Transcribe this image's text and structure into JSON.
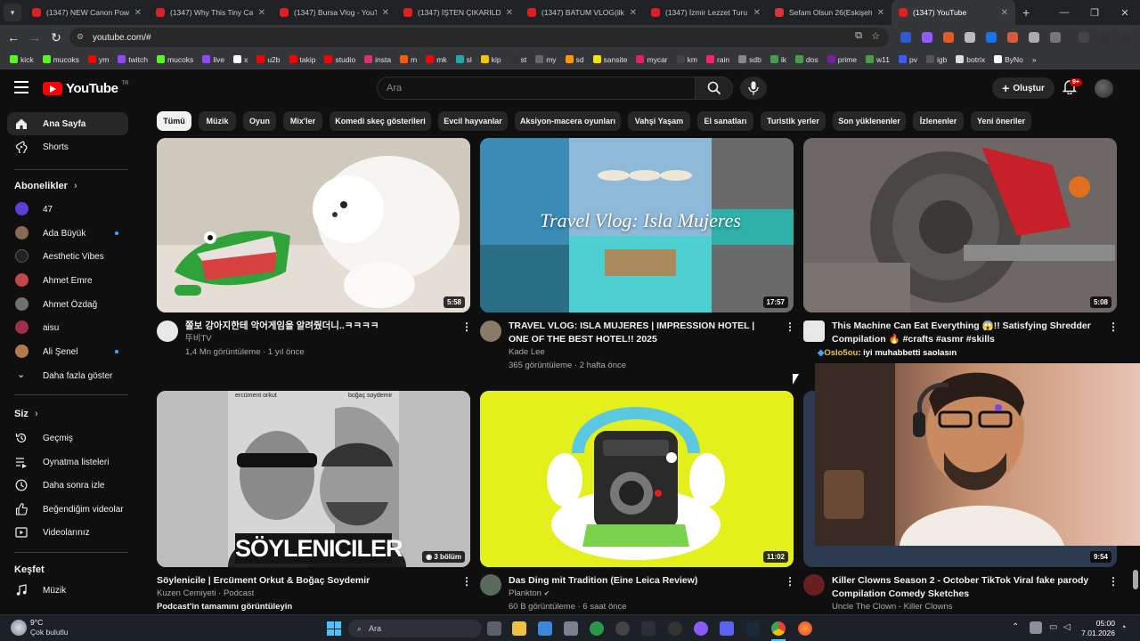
{
  "browser": {
    "tabs": [
      {
        "title": "(1347) NEW Canon Powe",
        "active": false
      },
      {
        "title": "(1347) Why This Tiny Can",
        "active": false
      },
      {
        "title": "(1347) Bursa Vlog - YouTu",
        "active": false
      },
      {
        "title": "(1347) İŞTEN ÇIKARILDIM",
        "active": false
      },
      {
        "title": "(1347) BATUM VLOG(ilk y",
        "active": false
      },
      {
        "title": "(1347) İzmir Lezzet Turu -",
        "active": false
      },
      {
        "title": "Sefam Olsun 26(Eskişehir",
        "active": false
      },
      {
        "title": "(1347) YouTube",
        "active": true
      }
    ],
    "url": "youtube.com/#",
    "bookmarks": [
      "kick",
      "mucoks",
      "ym",
      "twitch",
      "mucoks",
      "live",
      "x",
      "u2b",
      "takip",
      "studio",
      "insta",
      "m",
      "mk",
      "sl",
      "kip",
      "st",
      "my",
      "sd",
      "sansite",
      "mycar",
      "km",
      "rain",
      "sdb",
      "ik",
      "dos",
      "prime",
      "w11",
      "pv",
      "igb",
      "botrix",
      "ByNo"
    ]
  },
  "youtube": {
    "logo_text": "YouTube",
    "logo_region": "TR",
    "search_placeholder": "Ara",
    "create_label": "Oluştur",
    "notification_count": "9+"
  },
  "sidebar": {
    "main": [
      {
        "label": "Ana Sayfa",
        "icon": "home-icon",
        "active": true
      },
      {
        "label": "Shorts",
        "icon": "shorts-icon",
        "active": false
      }
    ],
    "subscriptions_header": "Abonelikler",
    "subscriptions": [
      {
        "label": "47",
        "new": false,
        "color": "#5b3fd6"
      },
      {
        "label": "Ada Büyük",
        "new": true,
        "color": "#8a6a52"
      },
      {
        "label": "Aesthetic Vibes",
        "new": false,
        "color": "#222222"
      },
      {
        "label": "Ahmet Emre",
        "new": false,
        "color": "#c0484a"
      },
      {
        "label": "Ahmet Özdağ",
        "new": false,
        "color": "#707070"
      },
      {
        "label": "aisu",
        "new": false,
        "color": "#a0304a"
      },
      {
        "label": "Ali Şenel",
        "new": true,
        "color": "#b57a4a"
      }
    ],
    "show_more": "Daha fazla göster",
    "you_header": "Siz",
    "you_items": [
      {
        "label": "Geçmiş",
        "icon": "history-icon"
      },
      {
        "label": "Oynatma listeleri",
        "icon": "playlists-icon"
      },
      {
        "label": "Daha sonra izle",
        "icon": "watch-later-icon"
      },
      {
        "label": "Beğendiğim videolar",
        "icon": "like-icon"
      },
      {
        "label": "Videolarınız",
        "icon": "your-videos-icon"
      }
    ],
    "explore_header": "Keşfet",
    "explore_items": [
      {
        "label": "Müzik",
        "icon": "music-icon"
      }
    ]
  },
  "chips": [
    "Tümü",
    "Müzik",
    "Oyun",
    "Mix'ler",
    "Komedi skeç gösterileri",
    "Evcil hayvanlar",
    "Aksiyon-macera oyunları",
    "Vahşi Yaşam",
    "El sanatları",
    "Turistik yerler",
    "Son yüklenenler",
    "İzlenenler",
    "Yeni öneriler"
  ],
  "videos": [
    {
      "title": "쫄보 강아지한테 악어게임을 알려줬더니..ㅋㅋㅋㅋ",
      "channel": "뚜비TV",
      "stats": "1,4 Mn görüntüleme · 1 yıl önce",
      "duration": "5:58"
    },
    {
      "title": "TRAVEL VLOG: ISLA MUJERES | IMPRESSION HOTEL | ONE OF THE BEST HOTEL!! 2025",
      "channel": "Kade Lee",
      "stats": "365 görüntüleme · 2 hafta önce",
      "duration": "17:57",
      "overlay": "Travel Vlog: Isla Mujeres"
    },
    {
      "title": "This Machine Can Eat Everything 😱!! Satisfying Shredder Compilation 🔥 #crafts #asmr #skills",
      "channel": "",
      "stats": "",
      "duration": "5:08"
    },
    {
      "title": "Söylenicile | Ercüment Orkut & Boğaç Soydemir",
      "channel": "Kuzen Cemiyeti · Podcast",
      "stats": "Podcast'in tamamını görüntüleyin",
      "duration": "3 bölüm",
      "overlay": "SÖYLENICILER",
      "cover_left": "ercüment orkut",
      "cover_right": "boğaç soydemir"
    },
    {
      "title": "Das Ding mit Tradition (Eine Leica Review)",
      "channel": "Plankton",
      "stats": "60 B görüntüleme · 6 saat önce",
      "duration": "11:02"
    },
    {
      "title": "Killer Clowns Season 2 - October TikTok Viral fake parody Compilation Comedy Sketches",
      "channel": "Uncle The Clown - Killer Clowns",
      "stats": "",
      "duration": "9:54"
    }
  ],
  "stream_overlay": {
    "chat_user": "Oslo5ou",
    "chat_message": ": iyi muhabbetti saolasın"
  },
  "taskbar": {
    "weather_temp": "9°C",
    "weather_desc": "Çok bulutlu",
    "search_label": "Ara",
    "time": "05:00",
    "date": "7.01.2026"
  }
}
